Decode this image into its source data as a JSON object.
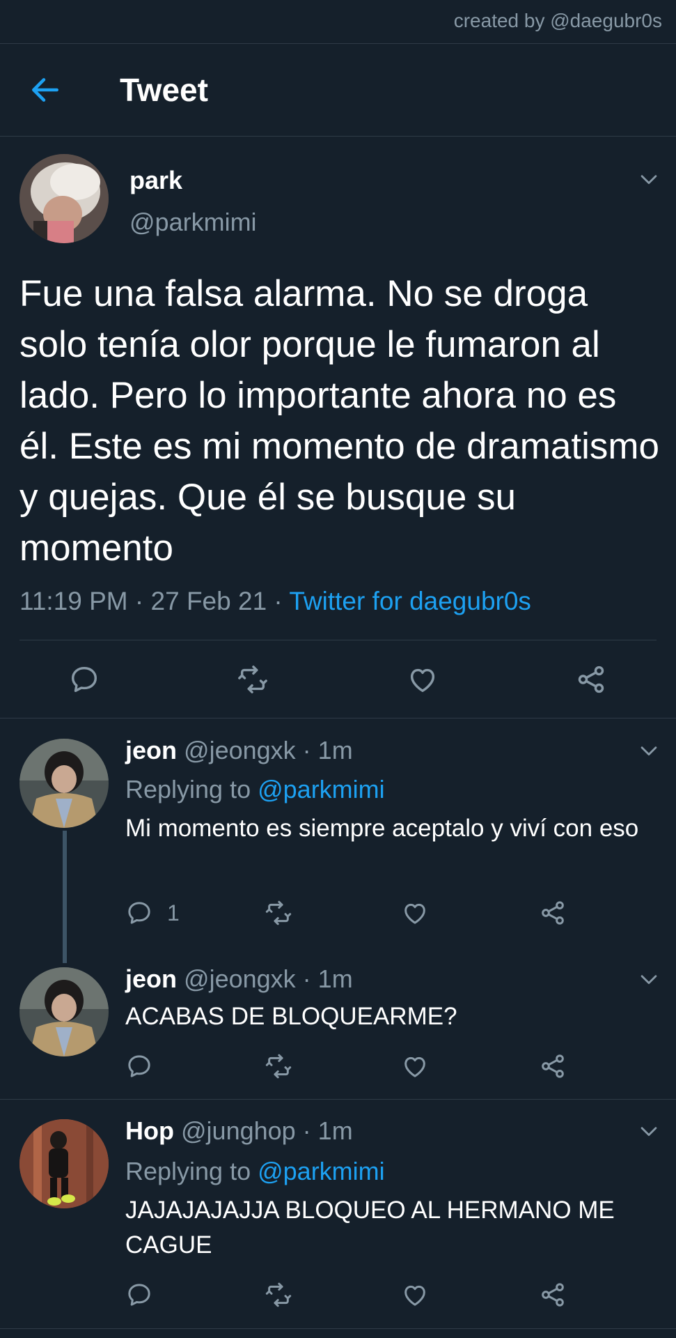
{
  "watermark": "created by @daegubr0s",
  "header": {
    "title": "Tweet",
    "back_icon": "arrow-left-icon"
  },
  "main_tweet": {
    "name": "park",
    "handle": "@parkmimi",
    "text": "Fue una falsa alarma. No se droga solo tenía olor porque le fumaron al lado. Pero lo importante ahora no es él. Este es mi momento de dramatismo y quejas. Que él se busque su momento",
    "time": "11:19 PM",
    "sep1": " · ",
    "date": "27 Feb 21",
    "sep2": " · ",
    "source": "Twitter for daegubr0s"
  },
  "replies": [
    {
      "name": "jeon",
      "handle": "@jeongxk",
      "time_sep": " · ",
      "time": "1m",
      "replying_prefix": "Replying to ",
      "replying_handle": "@parkmimi",
      "text": "Mi momento es siempre aceptalo y viví con eso",
      "reply_count": "1"
    },
    {
      "name": "jeon",
      "handle": "@jeongxk",
      "time_sep": " · ",
      "time": "1m",
      "text": "ACABAS DE BLOQUEARME?"
    },
    {
      "name": "Hop",
      "handle": "@junghop",
      "time_sep": " · ",
      "time": "1m",
      "replying_prefix": "Replying to ",
      "replying_handle": "@parkmimi",
      "text": "JAJAJAJAJJA BLOQUEO AL HERMANO ME CAGUE"
    }
  ],
  "colors": {
    "background": "#15202b",
    "text": "#ffffff",
    "muted": "#8899a6",
    "accent": "#1da1f2",
    "divider": "#2f3b47"
  }
}
